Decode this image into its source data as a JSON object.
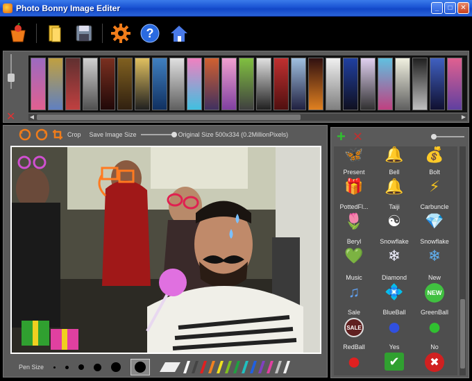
{
  "window": {
    "title": "Photo Bonny Image Editer"
  },
  "toolbar": {
    "buttons": [
      "open-photo",
      "open-folder",
      "save",
      "settings",
      "help",
      "home"
    ]
  },
  "edit_bar": {
    "crop_label": "Crop",
    "save_size_label": "Save Image Size",
    "original_size_text": "Original Size 500x334 (0.2MillionPixels)"
  },
  "pen": {
    "label": "Pen Size"
  },
  "stickers": [
    {
      "label": "",
      "icon": "🦋"
    },
    {
      "label": "",
      "icon": "🔔"
    },
    {
      "label": "",
      "icon": "💰"
    },
    {
      "label": "Present",
      "icon": "🎁"
    },
    {
      "label": "Bell",
      "icon": "🔔"
    },
    {
      "label": "Bolt",
      "icon": "⚡"
    },
    {
      "label": "PottedFl...",
      "icon": "🌷"
    },
    {
      "label": "Taiji",
      "icon": "☯"
    },
    {
      "label": "Carbuncle",
      "icon": "💎"
    },
    {
      "label": "Beryl",
      "icon": "💚"
    },
    {
      "label": "Snowflake",
      "icon": "❄"
    },
    {
      "label": "Snowflake",
      "icon": "❄"
    },
    {
      "label": "Music",
      "icon": "♫"
    },
    {
      "label": "Diamond",
      "icon": "💠"
    },
    {
      "label": "New",
      "icon": "NEW"
    },
    {
      "label": "Sale",
      "icon": "SALE"
    },
    {
      "label": "BlueBall",
      "icon": "●"
    },
    {
      "label": "GreenBall",
      "icon": "●"
    },
    {
      "label": "RedBall",
      "icon": "●"
    },
    {
      "label": "Yes",
      "icon": "✔"
    },
    {
      "label": "No",
      "icon": "✖"
    }
  ],
  "colors": {
    "title_bar": "#1a54d4",
    "panel": "#5a5a5a",
    "accent_orange": "#f07c1a"
  }
}
